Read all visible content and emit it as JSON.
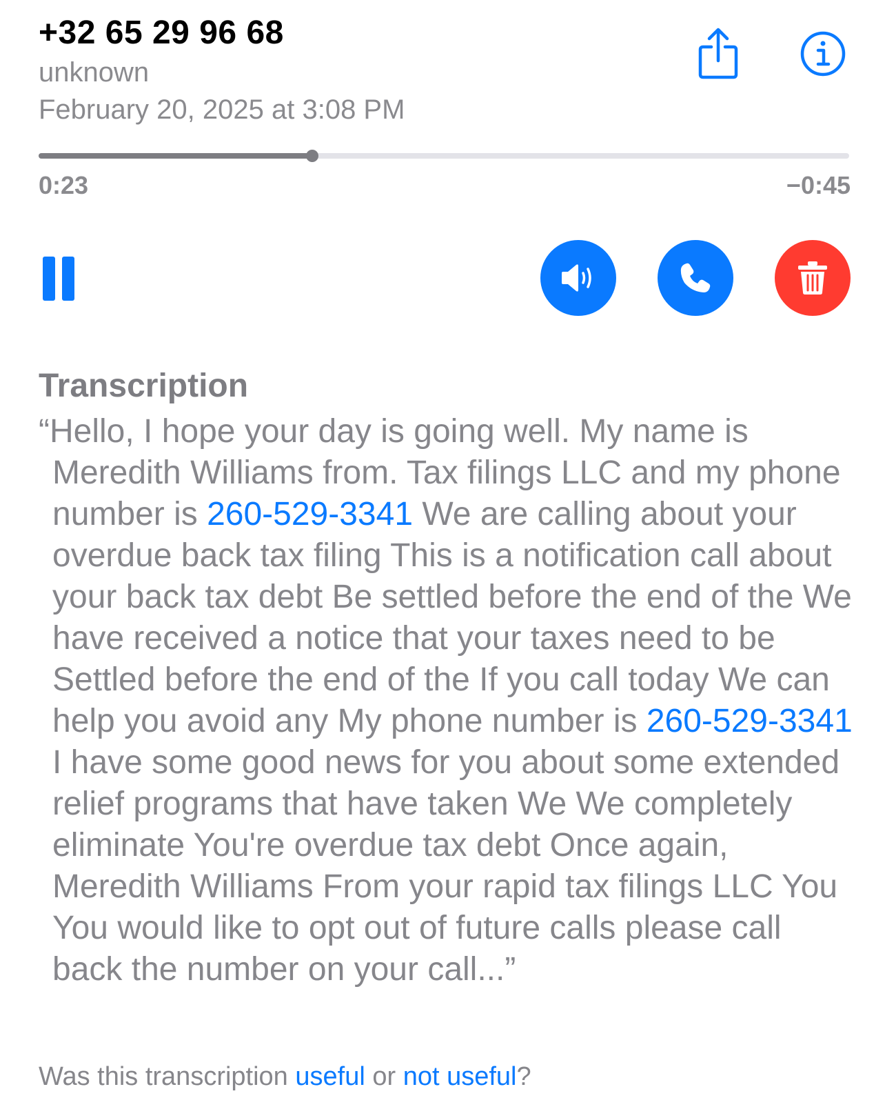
{
  "header": {
    "number": "+32 65 29 96 68",
    "label": "unknown",
    "datetime": "February 20, 2025 at 3:08 PM"
  },
  "playback": {
    "elapsed": "0:23",
    "remaining": "−0:45",
    "progress_fraction": 0.338
  },
  "icons": {
    "share": "share-icon",
    "info": "info-icon",
    "pause": "pause-icon",
    "speaker": "speaker-icon",
    "call": "phone-icon",
    "delete": "trash-icon"
  },
  "colors": {
    "accent": "#0a7aff",
    "delete": "#ff3b30",
    "secondary_text": "#86868b"
  },
  "transcription": {
    "heading": "Transcription",
    "part1": "“Hello, I hope your day is going well. My name is Meredith Williams from. Tax filings LLC and my phone number is ",
    "phone1": "260-529-3341",
    "part2": " We are calling about your overdue back tax filing This is a notification call about your back tax debt Be settled before the end of the We have received a notice that your taxes need to be Settled before the end of the If you call today We can help you avoid any My phone number is ",
    "phone2": "260-529-3341",
    "part3": " I have some good news for you about some extended relief programs that have taken We We completely eliminate You're overdue tax debt Once again, Meredith Williams From your rapid tax filings LLC You You would like to opt out of future calls please call back the number on your call...”"
  },
  "feedback": {
    "prefix": "Was this transcription ",
    "useful": "useful",
    "or": " or ",
    "not_useful": "not useful",
    "suffix": "?"
  }
}
